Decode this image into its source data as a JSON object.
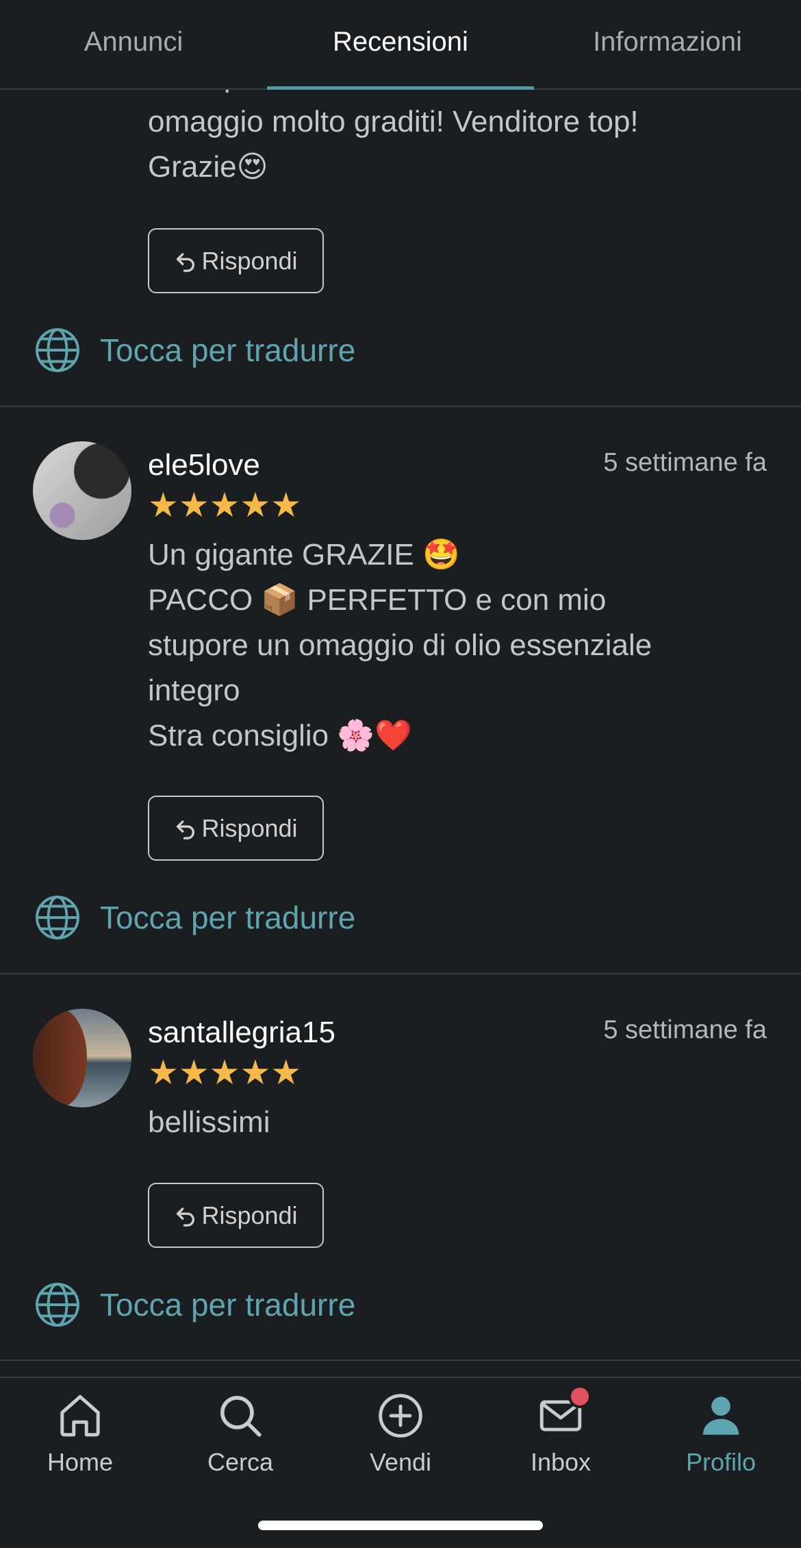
{
  "tabs": [
    {
      "label": "Annunci"
    },
    {
      "label": "Recensioni"
    },
    {
      "label": "Informazioni"
    }
  ],
  "reviews": [
    {
      "comment": "Tutto perfetto e con due flaconcini in\nomaggio molto graditi! Venditore top!\nGrazie😍",
      "reply_label": "Rispondi",
      "translate_label": "Tocca per tradurre"
    },
    {
      "username": "ele5love",
      "time": "5 settimane fa",
      "stars": "★★★★★",
      "rating": 5,
      "comment": "Un gigante GRAZIE 🤩\nPACCO 📦 PERFETTO e con mio\nstupore un omaggio di olio essenziale\nintegro\nStra consiglio 🌸❤️",
      "reply_label": "Rispondi",
      "translate_label": "Tocca per tradurre"
    },
    {
      "username": "santallegria15",
      "time": "5 settimane fa",
      "stars": "★★★★★",
      "rating": 5,
      "comment": "bellissimi",
      "reply_label": "Rispondi",
      "translate_label": "Tocca per tradurre"
    }
  ],
  "bottom_nav": [
    {
      "label": "Home",
      "icon": "home-icon"
    },
    {
      "label": "Cerca",
      "icon": "search-icon"
    },
    {
      "label": "Vendi",
      "icon": "plus-circle-icon"
    },
    {
      "label": "Inbox",
      "icon": "mail-icon"
    },
    {
      "label": "Profilo",
      "icon": "profile-icon"
    }
  ],
  "colors": {
    "background": "#1b1e20",
    "accent": "#5fa5b0",
    "star": "#f5b94a",
    "badge": "#e05260"
  }
}
